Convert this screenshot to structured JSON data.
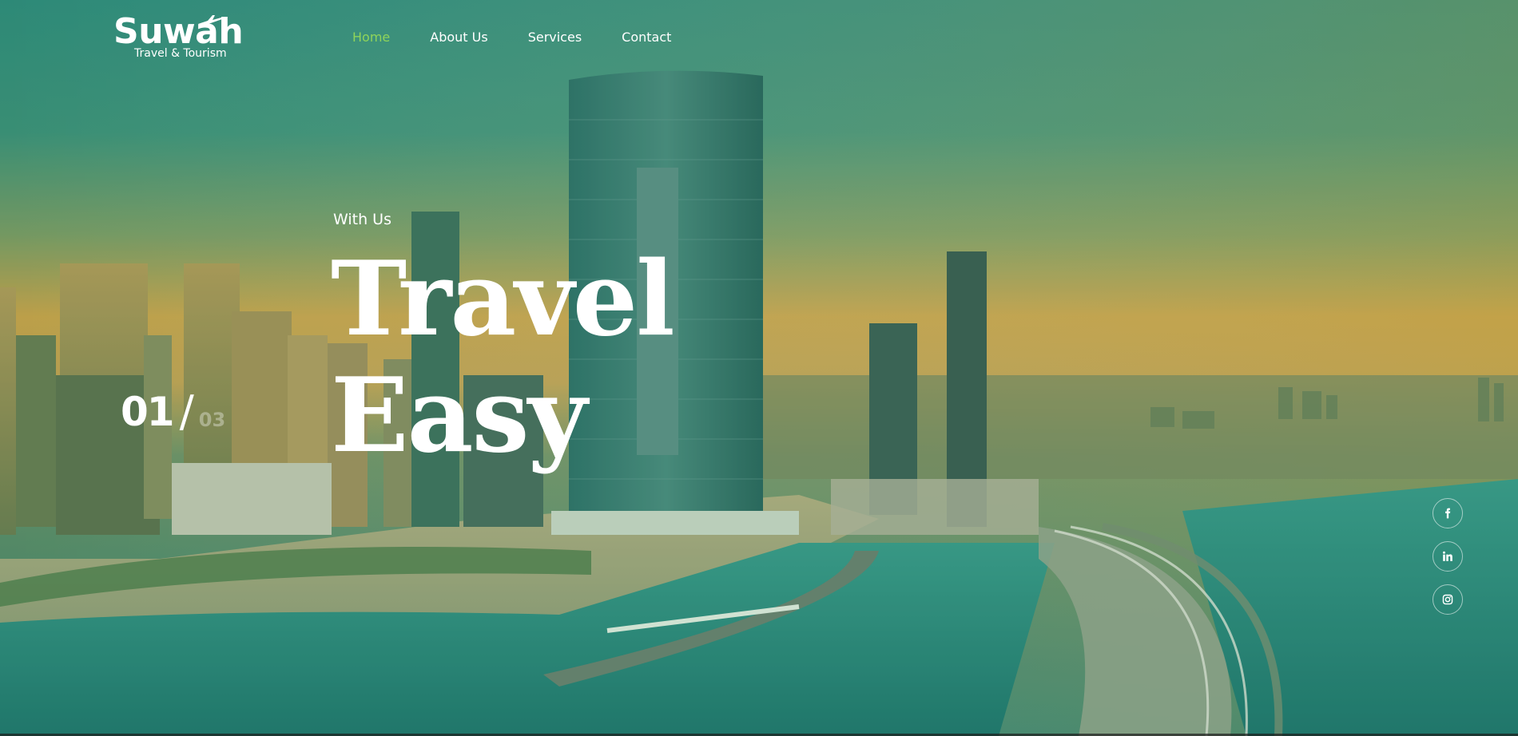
{
  "brand": {
    "name": "Suwah",
    "tagline": "Travel & Tourism"
  },
  "nav": {
    "items": [
      {
        "label": "Home",
        "active": true
      },
      {
        "label": "About Us",
        "active": false
      },
      {
        "label": "Services",
        "active": false
      },
      {
        "label": "Contact",
        "active": false
      }
    ]
  },
  "hero": {
    "kicker": "With Us",
    "headline_line1": "Travel",
    "headline_line2": "Easy",
    "background": "city-skyline-coast-image"
  },
  "slider": {
    "current": "01",
    "separator": "/",
    "total": "03"
  },
  "social": {
    "items": [
      {
        "icon": "facebook-icon"
      },
      {
        "icon": "linkedin-icon"
      },
      {
        "icon": "instagram-icon"
      }
    ]
  },
  "colors": {
    "accent": "#8fd45a",
    "overlay_top": "#2f8a77",
    "overlay_horizon": "#e0a53a",
    "water": "#2b8c82"
  }
}
